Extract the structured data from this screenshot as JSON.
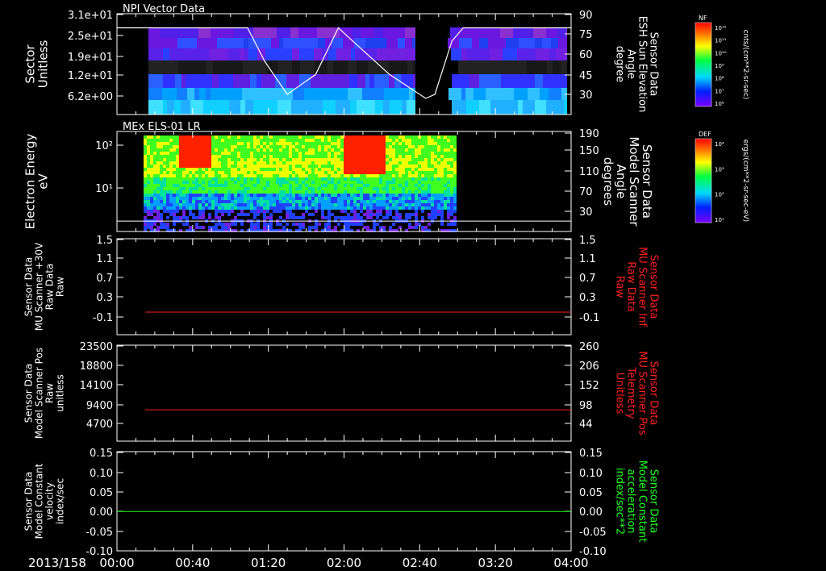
{
  "panels": [
    {
      "title": "NPI Vector Data",
      "type": "spectrogram",
      "ylabel": [
        "Sector",
        "Unitless"
      ],
      "ylabel_color": "#ffffff",
      "yticks": [
        "3.1e+01",
        "2.5e+01",
        "1.9e+01",
        "1.2e+01",
        "6.2e+00"
      ],
      "y2label": [
        "Sensor Data",
        "ESH Sun Elevation",
        "Angle",
        "degree"
      ],
      "y2label_color": "#ffffff",
      "y2ticks": [
        "90",
        "75",
        "60",
        "45",
        "30"
      ],
      "overlay_series": {
        "name": "Sensor Data ESH Sun Elevation Angle",
        "color": "#ffffff",
        "x_hours": [
          0.0,
          1.15,
          1.3,
          1.5,
          1.75,
          1.95,
          2.0,
          2.4,
          2.72,
          2.8,
          2.95,
          3.05,
          4.0
        ],
        "y": [
          80,
          80,
          55,
          30,
          45,
          80,
          76,
          45,
          27,
          30,
          70,
          80,
          80
        ]
      }
    },
    {
      "title": "MEx ELS-01 LR",
      "type": "spectrogram",
      "ylabel": [
        "Electron Energy",
        "eV"
      ],
      "ylabel_color": "#ffffff",
      "yticks": [
        "10²",
        "10¹"
      ],
      "y2label": [
        "Sensor Data",
        "Model Scanner",
        "Angle",
        "degrees"
      ],
      "y2label_color": "#ffffff",
      "y2ticks": [
        "190",
        "150",
        "110",
        "70",
        "30"
      ],
      "overlay_series": {
        "name": "Sensor Data Model Scanner Angle",
        "color": "#ffffff",
        "x_hours": [
          0.0,
          4.0
        ],
        "y": [
          10,
          10
        ]
      }
    },
    {
      "title": "",
      "type": "line",
      "ylabel": [
        "Sensor Data",
        "MU Scanner +30V",
        "Raw Data",
        "Raw"
      ],
      "ylabel_color": "#ffffff",
      "yticks": [
        "1.5",
        "1.1",
        "0.7",
        "0.3",
        "-0.1"
      ],
      "y2label": [
        "Sensor Data",
        "MU Scanner Inf",
        "Raw Data",
        "Raw"
      ],
      "y2label_color": "#ff2020",
      "y2ticks": [
        "1.5",
        "1.1",
        "0.7",
        "0.3",
        "-0.1"
      ],
      "ylim": [
        -0.3,
        1.5
      ],
      "series": [
        {
          "color": "#ff2020",
          "x_hours": [
            0.25,
            4.0
          ],
          "y": [
            0.0,
            0.0
          ]
        }
      ]
    },
    {
      "title": "",
      "type": "line",
      "ylabel": [
        "Sensor Data",
        "Model Scanner Pos",
        "Raw",
        "unitless"
      ],
      "ylabel_color": "#ffffff",
      "yticks": [
        "23500",
        "18800",
        "14100",
        "9400",
        "4700"
      ],
      "y2label": [
        "Sensor Data",
        "MU Scanner Pos",
        "Telemetry",
        "Unitless"
      ],
      "y2label_color": "#ff2020",
      "y2ticks": [
        "260",
        "206",
        "152",
        "98",
        "44"
      ],
      "ylim": [
        0,
        23500
      ],
      "series": [
        {
          "color": "#ff2020",
          "x_hours": [
            0.25,
            4.0
          ],
          "y": [
            8000,
            8000
          ]
        }
      ]
    },
    {
      "title": "",
      "type": "line",
      "ylabel": [
        "Sensor Data",
        "Model Constant",
        "velocity",
        "index/sec"
      ],
      "ylabel_color": "#ffffff",
      "yticks": [
        "0.15",
        "0.10",
        "0.05",
        "0.00",
        "-0.05",
        "-0.10"
      ],
      "y2label": [
        "Sensor Data",
        "Model Constant",
        "acceleration",
        "index/sec**2"
      ],
      "y2label_color": "#20ff20",
      "y2ticks": [
        "0.15",
        "0.10",
        "0.05",
        "0.00",
        "-0.05",
        "-0.10"
      ],
      "ylim": [
        -0.1,
        0.15
      ],
      "series": [
        {
          "color": "#20ff20",
          "x_hours": [
            0.0,
            4.0
          ],
          "y": [
            0.0,
            0.0
          ]
        }
      ]
    }
  ],
  "xaxis": {
    "date": "2013/158",
    "ticks": [
      "00:00",
      "00:40",
      "01:20",
      "02:00",
      "02:40",
      "03:20",
      "04:00"
    ]
  },
  "colorbars": [
    {
      "name": "NF",
      "title": "cnts/(cm**2-sr-sec)",
      "ticks": [
        "10¹²",
        "10¹¹",
        "10¹⁰",
        "10⁹",
        "10⁸",
        "10⁷",
        "10⁶"
      ]
    },
    {
      "name": "DEF",
      "title": "ergs/(cm**2-sr-sec-eV)",
      "ticks": [
        "10⁴",
        "10³",
        "10²",
        "10¹"
      ]
    }
  ],
  "chart_data": [
    {
      "type": "heatmap",
      "title": "NPI Vector Data",
      "ylabel": "Sector Unitless",
      "y2label": "Sensor Data ESH Sun Elevation Angle degree",
      "x_range": [
        "00:00",
        "04:00"
      ],
      "colorbar": "NF cnts/(cm**2-sr-sec)"
    },
    {
      "type": "heatmap",
      "title": "MEx ELS-01 LR",
      "ylabel": "Electron Energy eV",
      "y2label": "Sensor Data Model Scanner Angle degrees",
      "x_range": [
        "00:00",
        "04:00"
      ],
      "colorbar": "DEF ergs/(cm**2-sr-sec-eV)"
    },
    {
      "type": "line",
      "ylabel": "Sensor Data MU Scanner +30V Raw Data Raw",
      "y2label": "Sensor Data MU Scanner Inf Raw Data Raw",
      "x": [
        "00:15",
        "04:00"
      ],
      "series": [
        {
          "values": [
            0.0,
            0.0
          ]
        }
      ],
      "ylim": [
        -0.3,
        1.5
      ]
    },
    {
      "type": "line",
      "ylabel": "Sensor Data Model Scanner Pos Raw unitless",
      "y2label": "Sensor Data MU Scanner Pos Telemetry Unitless",
      "x": [
        "00:15",
        "04:00"
      ],
      "series": [
        {
          "values": [
            8000,
            8000
          ]
        }
      ],
      "ylim": [
        0,
        23500
      ]
    },
    {
      "type": "line",
      "ylabel": "Sensor Data Model Constant velocity index/sec",
      "y2label": "Sensor Data Model Constant acceleration index/sec**2",
      "x": [
        "00:00",
        "04:00"
      ],
      "series": [
        {
          "values": [
            0.0,
            0.0
          ]
        }
      ],
      "ylim": [
        -0.1,
        0.15
      ]
    }
  ]
}
